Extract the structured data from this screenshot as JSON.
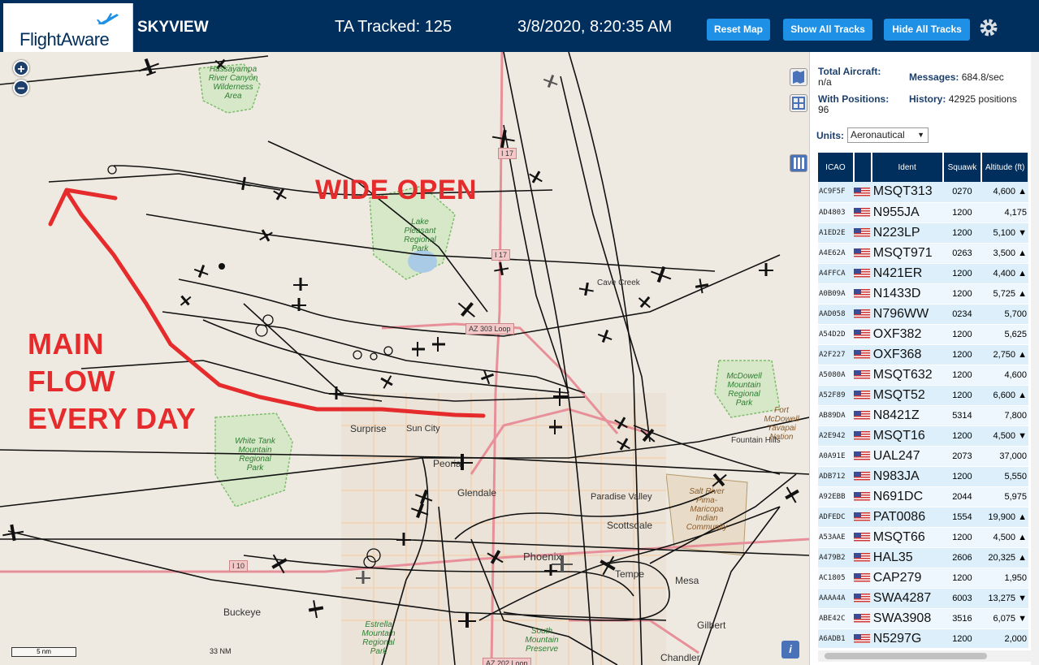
{
  "header": {
    "logo_text": "FlightAware",
    "app_title": "SKYVIEW",
    "ta_tracked": "TA Tracked: 125",
    "datetime": "3/8/2020, 8:20:35 AM",
    "reset_map": "Reset Map",
    "show_all_tracks": "Show All Tracks",
    "hide_all_tracks": "Hide All Tracks"
  },
  "map": {
    "zoom_in": "+",
    "zoom_out": "−",
    "annotation_wide_open": "WIDE OPEN",
    "annotation_main_flow": [
      "MAIN",
      "FLOW",
      "EVERY DAY"
    ],
    "scale_km": "5 nm",
    "scale_nm": "33 NM",
    "places": [
      "Surprise",
      "Sun City",
      "Peoria",
      "Glendale",
      "Paradise Valley",
      "Scottsdale",
      "Phoenix",
      "Tempe",
      "Mesa",
      "Gilbert",
      "Chandler",
      "Buckeye",
      "Cave Creek",
      "Fountain Hills"
    ],
    "parks": [
      "Hassayampa River Canyon Wilderness Area",
      "Lake Pleasant Regional Park",
      "White Tank Mountain Regional Park",
      "McDowell Mountain Regional Park",
      "Estrella Mountain Regional Park",
      "South Mountain Preserve",
      "Salt River Pima-Maricopa Indian Community",
      "Fort McDowell Yavapai Nation"
    ],
    "roads": [
      "I 17",
      "I 17",
      "AZ 303 Loop",
      "I 10",
      "AZ 202 Loop"
    ],
    "info_button": "i"
  },
  "panel": {
    "total_aircraft_label": "Total Aircraft:",
    "total_aircraft_value": "n/a",
    "with_positions_label": "With Positions:",
    "with_positions_value": "96",
    "messages_label": "Messages:",
    "messages_value": "684.8/sec",
    "history_label": "History:",
    "history_value": "42925 positions",
    "units_label": "Units:",
    "units_value": "Aeronautical",
    "columns": [
      "ICAO",
      "",
      "Ident",
      "Squawk",
      "Altitude (ft)"
    ],
    "rows": [
      {
        "icao": "AC9F5F",
        "ident": "MSQT313",
        "squawk": "0270",
        "alt": "4,600 ▲"
      },
      {
        "icao": "AD4803",
        "ident": "N955JA",
        "squawk": "1200",
        "alt": "4,175"
      },
      {
        "icao": "A1ED2E",
        "ident": "N223LP",
        "squawk": "1200",
        "alt": "5,100 ▼"
      },
      {
        "icao": "A4E62A",
        "ident": "MSQT971",
        "squawk": "0263",
        "alt": "3,500 ▲"
      },
      {
        "icao": "A4FFCA",
        "ident": "N421ER",
        "squawk": "1200",
        "alt": "4,400 ▲"
      },
      {
        "icao": "A0B09A",
        "ident": "N1433D",
        "squawk": "1200",
        "alt": "5,725 ▲"
      },
      {
        "icao": "AAD058",
        "ident": "N796WW",
        "squawk": "0234",
        "alt": "5,700"
      },
      {
        "icao": "A54D2D",
        "ident": "OXF382",
        "squawk": "1200",
        "alt": "5,625"
      },
      {
        "icao": "A2F227",
        "ident": "OXF368",
        "squawk": "1200",
        "alt": "2,750 ▲"
      },
      {
        "icao": "A5080A",
        "ident": "MSQT632",
        "squawk": "1200",
        "alt": "4,600"
      },
      {
        "icao": "A52F89",
        "ident": "MSQT52",
        "squawk": "1200",
        "alt": "6,600 ▲"
      },
      {
        "icao": "AB89DA",
        "ident": "N8421Z",
        "squawk": "5314",
        "alt": "7,800"
      },
      {
        "icao": "A2E942",
        "ident": "MSQT16",
        "squawk": "1200",
        "alt": "4,500 ▼"
      },
      {
        "icao": "A0A91E",
        "ident": "UAL247",
        "squawk": "2073",
        "alt": "37,000"
      },
      {
        "icao": "ADB712",
        "ident": "N983JA",
        "squawk": "1200",
        "alt": "5,550"
      },
      {
        "icao": "A92EBB",
        "ident": "N691DC",
        "squawk": "2044",
        "alt": "5,975"
      },
      {
        "icao": "ADFEDC",
        "ident": "PAT0086",
        "squawk": "1554",
        "alt": "19,900 ▲"
      },
      {
        "icao": "A53AAE",
        "ident": "MSQT66",
        "squawk": "1200",
        "alt": "4,500 ▲"
      },
      {
        "icao": "A479B2",
        "ident": "HAL35",
        "squawk": "2606",
        "alt": "20,325 ▲"
      },
      {
        "icao": "AC1805",
        "ident": "CAP279",
        "squawk": "1200",
        "alt": "1,950"
      },
      {
        "icao": "AAAA4A",
        "ident": "SWA4287",
        "squawk": "6003",
        "alt": "13,275 ▼"
      },
      {
        "icao": "ABE42C",
        "ident": "SWA3908",
        "squawk": "3516",
        "alt": "6,075 ▼"
      },
      {
        "icao": "A6ADB1",
        "ident": "N5297G",
        "squawk": "1200",
        "alt": "2,000"
      }
    ]
  },
  "colors": {
    "header_bg": "#002f5d",
    "button_bg": "#1e90e6",
    "annotation": "#e52b2b",
    "map_bg": "#efeae1",
    "park_green": "#2e7d32"
  }
}
